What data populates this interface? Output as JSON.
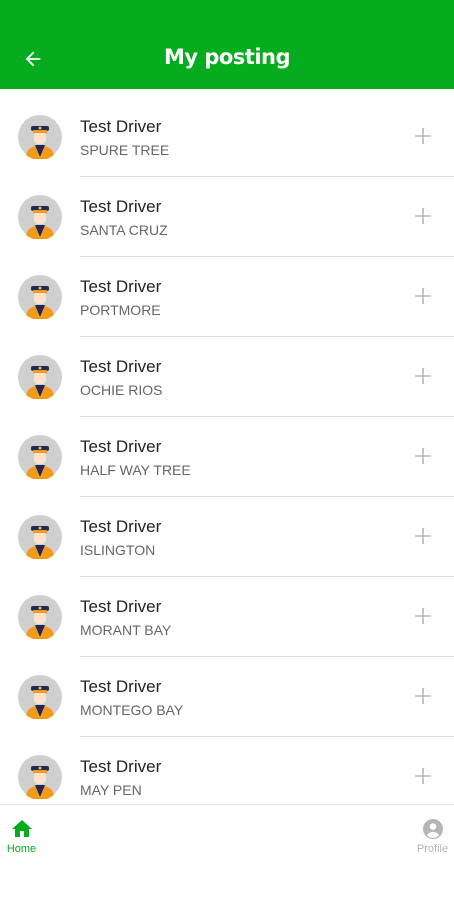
{
  "header": {
    "title": "My posting"
  },
  "items": [
    {
      "name": "Test Driver",
      "location": "SPURE TREE"
    },
    {
      "name": "Test Driver",
      "location": "SANTA CRUZ"
    },
    {
      "name": "Test Driver",
      "location": "PORTMORE"
    },
    {
      "name": "Test Driver",
      "location": "OCHIE RIOS"
    },
    {
      "name": "Test Driver",
      "location": "HALF WAY TREE"
    },
    {
      "name": "Test Driver",
      "location": "ISLINGTON"
    },
    {
      "name": "Test Driver",
      "location": "MORANT BAY"
    },
    {
      "name": "Test Driver",
      "location": "MONTEGO BAY"
    },
    {
      "name": "Test Driver",
      "location": "MAY PEN"
    }
  ],
  "nav": {
    "home": "Home",
    "profile": "Profile"
  },
  "colors": {
    "primary": "#05ad1e",
    "inactive": "#b5b5b5"
  },
  "icons": {
    "back": "arrow-left-icon",
    "avatar": "driver-avatar-icon",
    "add": "plus-icon",
    "home": "home-icon",
    "profile": "account-circle-icon"
  }
}
